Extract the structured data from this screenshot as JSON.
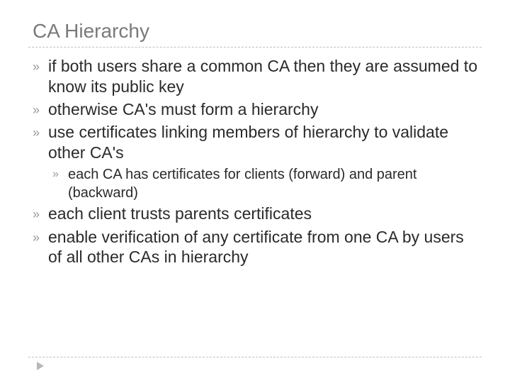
{
  "slide": {
    "title": "CA Hierarchy",
    "bullets": [
      {
        "text": "if both users share a common CA then they are assumed to know its public key"
      },
      {
        "text": "otherwise CA's must form a hierarchy"
      },
      {
        "text": "use certificates linking members of hierarchy to validate other CA's",
        "sub": [
          {
            "text": "each CA has certificates for clients (forward) and parent (backward)"
          }
        ]
      },
      {
        "text": "each client trusts parents certificates"
      },
      {
        "text": "enable verification of any certificate from one CA by users of all other CAs in hierarchy"
      }
    ]
  },
  "icons": {
    "bullet_glyph": "»"
  }
}
